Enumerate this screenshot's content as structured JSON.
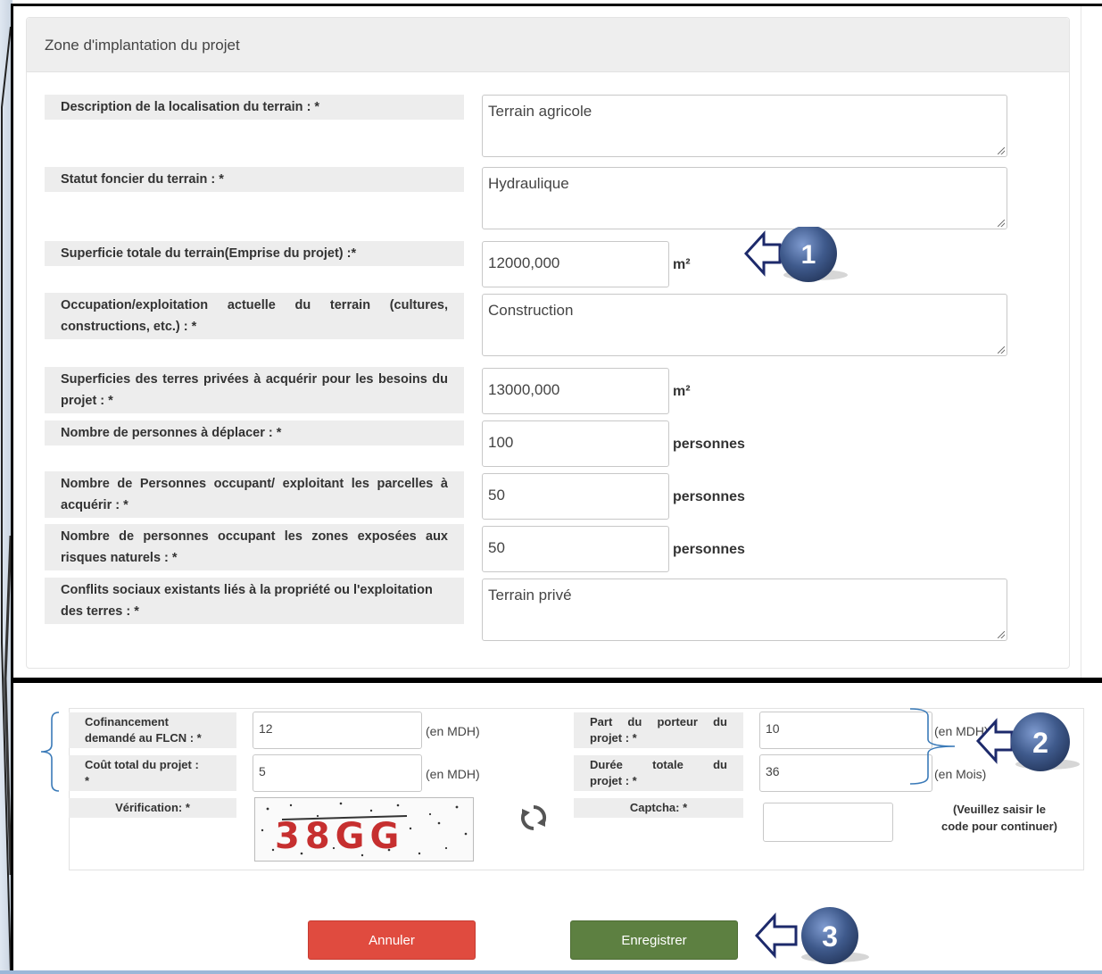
{
  "section": {
    "title": "Zone d'implantation du projet"
  },
  "fields": [
    {
      "label": [
        "Description de la localisation du terrain : *"
      ],
      "value": "Terrain agricole",
      "unit": ""
    },
    {
      "label": [
        "Statut foncier du terrain : *"
      ],
      "value": "Hydraulique",
      "unit": ""
    },
    {
      "label": [
        "Superficie totale du terrain(Emprise du projet) :*"
      ],
      "value": "12000,000",
      "unit": "m²"
    },
    {
      "label": [
        "Occupation/exploitation actuelle du terrain (cultures,",
        "constructions, etc.) : *"
      ],
      "value": "Construction",
      "unit": ""
    },
    {
      "label": [
        "Superficies des terres privées à acquérir pour les besoins du",
        "projet : *"
      ],
      "value": "13000,000",
      "unit": "m²"
    },
    {
      "label": [
        "Nombre de personnes à déplacer : *"
      ],
      "value": "100",
      "unit": "personnes"
    },
    {
      "label": [
        "Nombre de Personnes occupant/ exploitant les parcelles à",
        "acquérir : *"
      ],
      "value": "50",
      "unit": "personnes"
    },
    {
      "label": [
        "Nombre de personnes occupant les zones exposées aux",
        "risques naturels : *"
      ],
      "value": "50",
      "unit": "personnes"
    },
    {
      "label": [
        "Conflits sociaux existants liés à la propriété ou l'exploitation",
        "des terres : *"
      ],
      "value": "Terrain privé",
      "unit": ""
    }
  ],
  "financing": {
    "cofinancement": {
      "label": [
        "Cofinancement",
        "demandé au FLCN : *"
      ],
      "value": "12",
      "unit": "(en MDH)"
    },
    "cout_total": {
      "label": [
        "Coût total du projet :",
        "*"
      ],
      "value": "5",
      "unit": "(en MDH)"
    },
    "part_porteur": {
      "label": [
        "Part du porteur du",
        "projet : *"
      ],
      "value": "10",
      "unit": "(en MDH)"
    },
    "duree": {
      "label": [
        "Durée totale du",
        "projet : *"
      ],
      "value": "36",
      "unit": "(en Mois)"
    },
    "verification_label": "Vérification: *",
    "captcha_label": "Captcha: *",
    "captcha_text": "38GG",
    "captcha_value": "",
    "captcha_hint": [
      "(Veuillez saisir le",
      "code pour continuer)"
    ]
  },
  "buttons": {
    "cancel": "Annuler",
    "save": "Enregistrer"
  },
  "callouts": [
    "1",
    "2",
    "3"
  ],
  "colors": {
    "cancel": "#e04b3f",
    "save": "#5d8041",
    "callout": "#3f5a8c",
    "arrow": "#1d2a6b"
  }
}
